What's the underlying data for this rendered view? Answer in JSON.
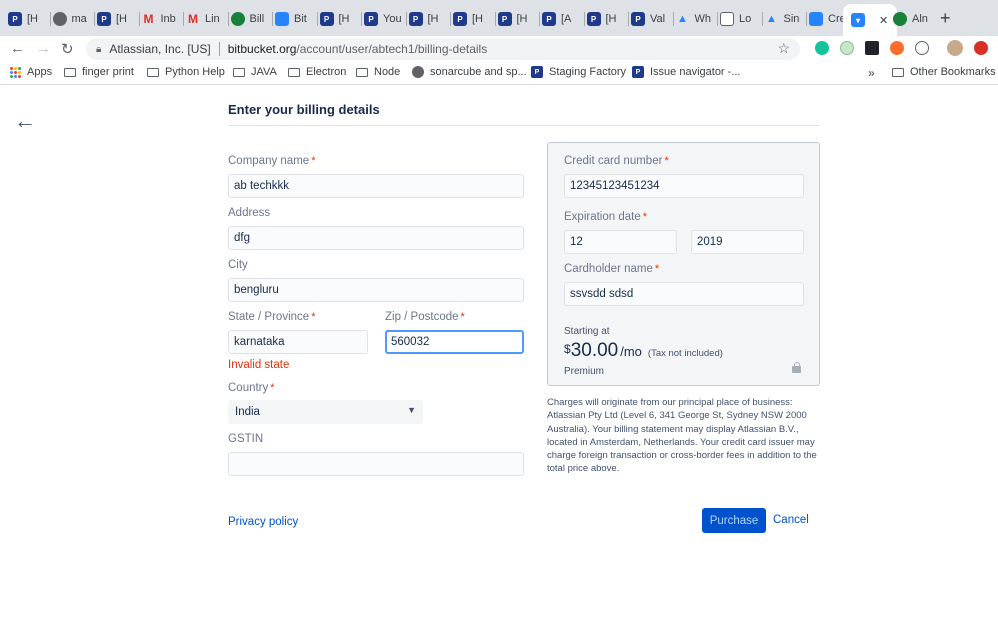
{
  "browser": {
    "tabs": [
      {
        "label": "[H",
        "icon": "jira-p-icon",
        "color": "#1f3a8a"
      },
      {
        "label": "ma",
        "icon": "globe-icon",
        "color": "#5f6368"
      },
      {
        "label": "[H",
        "icon": "jira-p-icon",
        "color": "#1f3a8a"
      },
      {
        "label": "Inb",
        "icon": "gmail-icon",
        "color": "#d93025"
      },
      {
        "label": "Lin",
        "icon": "gmail-icon",
        "color": "#d93025"
      },
      {
        "label": "Bill",
        "icon": "shield-icon",
        "color": "#188038"
      },
      {
        "label": "Bit",
        "icon": "bitbucket-icon",
        "color": "#2684ff"
      },
      {
        "label": "[H",
        "icon": "jira-p-icon",
        "color": "#1f3a8a"
      },
      {
        "label": "You",
        "icon": "jira-p-icon",
        "color": "#1f3a8a"
      },
      {
        "label": "[H",
        "icon": "jira-p-icon",
        "color": "#1f3a8a"
      },
      {
        "label": "[H",
        "icon": "jira-p-icon",
        "color": "#1f3a8a"
      },
      {
        "label": "[H",
        "icon": "jira-p-icon",
        "color": "#1f3a8a"
      },
      {
        "label": "[A",
        "icon": "jira-p-icon",
        "color": "#1f3a8a"
      },
      {
        "label": "[H",
        "icon": "jira-p-icon",
        "color": "#1f3a8a"
      },
      {
        "label": "Val",
        "icon": "jira-p-icon",
        "color": "#1f3a8a"
      },
      {
        "label": "Wh",
        "icon": "atlassian-icon",
        "color": "#2684ff"
      },
      {
        "label": "Lo",
        "icon": "doc-icon",
        "color": "#5f6368"
      },
      {
        "label": "Sin",
        "icon": "atlassian-icon",
        "color": "#2684ff"
      },
      {
        "label": "Cre",
        "icon": "bitbucket-icon",
        "color": "#2684ff"
      }
    ],
    "active_tab_close": "✕",
    "last_tab": {
      "label": "Aln",
      "icon": "shield-icon",
      "color": "#188038"
    },
    "new_tab": "+",
    "url_org": "Atlassian, Inc. [US]",
    "url_host": "bitbucket.org",
    "url_path": "/account/user/abtech1/billing-details",
    "bookmarks": [
      {
        "label": "Apps",
        "type": "apps"
      },
      {
        "label": "finger print",
        "type": "folder"
      },
      {
        "label": "Python Help",
        "type": "folder"
      },
      {
        "label": "JAVA",
        "type": "folder"
      },
      {
        "label": "Electron",
        "type": "folder"
      },
      {
        "label": "Node",
        "type": "folder"
      },
      {
        "label": "sonarcube and sp...",
        "type": "globe"
      },
      {
        "label": "Staging Factory",
        "type": "jira"
      },
      {
        "label": "Issue navigator -...",
        "type": "jira"
      }
    ],
    "more_bookmarks": "»",
    "other_bookmarks": "Other Bookmarks"
  },
  "page": {
    "title": "Enter your billing details",
    "company": {
      "label": "Company name",
      "value": "ab techkkk"
    },
    "address": {
      "label": "Address",
      "value": "dfg"
    },
    "city": {
      "label": "City",
      "value": "bengluru"
    },
    "state": {
      "label": "State / Province",
      "value": "karnataka",
      "error": "Invalid state"
    },
    "zip": {
      "label": "Zip / Postcode",
      "value": "560032"
    },
    "country": {
      "label": "Country",
      "value": "India"
    },
    "gstin": {
      "label": "GSTIN",
      "value": ""
    },
    "card": {
      "number_label": "Credit card number",
      "number_value": "12345123451234",
      "expiry_label": "Expiration date",
      "expiry_month": "12",
      "expiry_year": "2019",
      "holder_label": "Cardholder name",
      "holder_value": "ssvsdd sdsd",
      "starting_at": "Starting at",
      "currency": "$",
      "amount": "30.00",
      "per": "/mo",
      "tax_note": "(Tax not included)",
      "plan": "Premium"
    },
    "notice": "Charges will originate from our principal place of business: Atlassian Pty Ltd (Level 6, 341 George St, Sydney NSW 2000 Australia). Your billing statement may display Atlassian B.V., located in Amsterdam, Netherlands. Your credit card issuer may charge foreign transaction or cross-border fees in addition to the total price above.",
    "privacy_link": "Privacy policy",
    "purchase_button": "Purchase",
    "cancel_link": "Cancel",
    "required_mark": "*"
  }
}
